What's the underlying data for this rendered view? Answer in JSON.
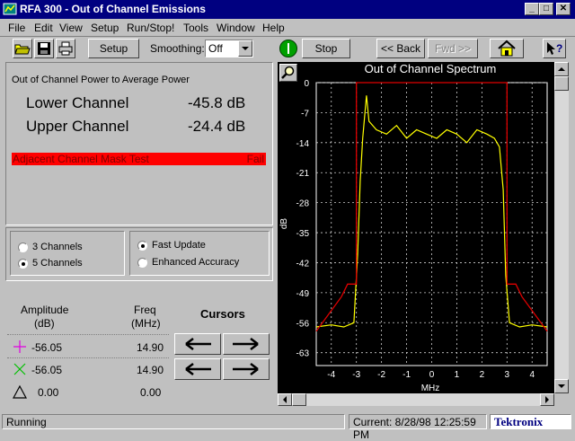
{
  "window": {
    "title": "RFA 300 - Out of Channel Emissions",
    "min_label": "_",
    "max_label": "□",
    "close_label": "✕"
  },
  "menu": [
    "File",
    "Edit",
    "View",
    "Setup",
    "Run/Stop!",
    "Tools",
    "Window",
    "Help"
  ],
  "toolbar": {
    "setup_label": "Setup",
    "smoothing_label": "Smoothing:",
    "smoothing_value": "Off",
    "stop_label": "Stop",
    "back_label": "<< Back",
    "fwd_label": "Fwd >>",
    "run_indicator_color": "#00a000"
  },
  "measure": {
    "heading": "Out of Channel Power to Average Power",
    "lower_label": "Lower Channel",
    "lower_value": "-45.8 dB",
    "upper_label": "Upper Channel",
    "upper_value": "-24.4 dB",
    "mask_label": "Adjacent Channel Mask Test",
    "mask_result": "Fail",
    "mask_color": "#ff0000"
  },
  "options": {
    "channels": [
      {
        "label": "3 Channels",
        "selected": false
      },
      {
        "label": "5 Channels",
        "selected": true
      }
    ],
    "update": [
      {
        "label": "Fast Update",
        "selected": true
      },
      {
        "label": "Enhanced Accuracy",
        "selected": false
      }
    ]
  },
  "cursors": {
    "amp_header": "Amplitude",
    "amp_unit": "(dB)",
    "freq_header": "Freq",
    "freq_unit": "(MHz)",
    "title": "Cursors",
    "rows": [
      {
        "marker": "plus-marker",
        "color": "#e000e0",
        "amplitude": "-56.05",
        "freq": "14.90"
      },
      {
        "marker": "x-marker",
        "color": "#00c000",
        "amplitude": "-56.05",
        "freq": "14.90"
      },
      {
        "marker": "triangle-marker",
        "color": "#000000",
        "amplitude": "0.00",
        "freq": "0.00"
      }
    ]
  },
  "chart_data": {
    "type": "line",
    "title": "Out of Channel Spectrum",
    "xlabel": "MHz",
    "ylabel": "dB",
    "xlim": [
      -4.6,
      4.6
    ],
    "ylim": [
      -66,
      0
    ],
    "xticks": [
      -4,
      -3,
      -2,
      -1,
      0,
      1,
      2,
      3,
      4
    ],
    "yticks": [
      0,
      -7,
      -14,
      -21,
      -28,
      -35,
      -42,
      -49,
      -56,
      -63
    ],
    "grid": true,
    "series": [
      {
        "color": "#ffff00",
        "x": [
          -4.6,
          -4.0,
          -3.5,
          -3.1,
          -2.95,
          -2.85,
          -2.75,
          -2.6,
          -2.5,
          -2.2,
          -1.8,
          -1.4,
          -1.0,
          -0.6,
          -0.2,
          0.2,
          0.6,
          1.0,
          1.4,
          1.8,
          2.2,
          2.5,
          2.7,
          2.85,
          2.95,
          3.1,
          3.5,
          4.0,
          4.6
        ],
        "y": [
          -57,
          -56.5,
          -57,
          -56,
          -40,
          -23,
          -13,
          -3,
          -9,
          -11,
          -12,
          -10,
          -13,
          -11,
          -12,
          -13,
          -11,
          -12,
          -14,
          -11,
          -12,
          -13,
          -15,
          -25,
          -45,
          -56,
          -57,
          -56.5,
          -57
        ]
      },
      {
        "color": "#e00000",
        "x": [
          -4.6,
          -3.6,
          -3.35,
          -3.05,
          -3.0,
          -3.0,
          3.0,
          3.0,
          3.05,
          3.35,
          3.6,
          4.6
        ],
        "y": [
          -58,
          -50,
          -47,
          -47,
          -47,
          0,
          0,
          -47,
          -47,
          -47,
          -50,
          -58
        ]
      }
    ]
  },
  "status": {
    "left": "Running",
    "current": "Current: 8/28/98 12:25:59 PM",
    "brand": "Tektronix"
  }
}
